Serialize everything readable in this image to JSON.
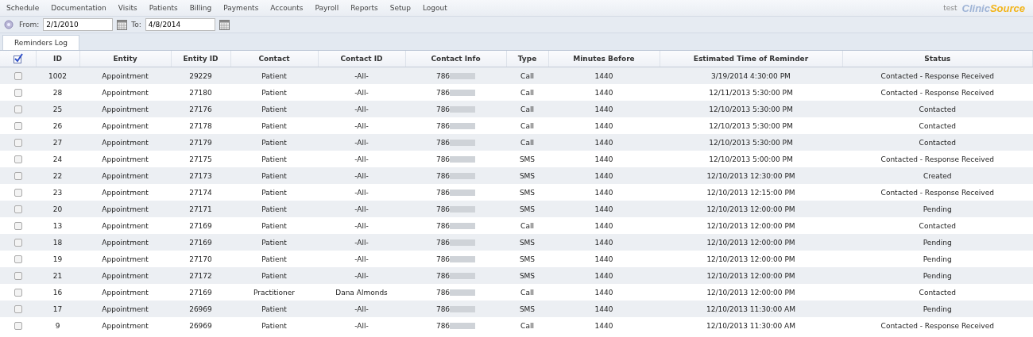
{
  "menu": [
    "Schedule",
    "Documentation",
    "Visits",
    "Patients",
    "Billing",
    "Payments",
    "Accounts",
    "Payroll",
    "Reports",
    "Setup",
    "Logout"
  ],
  "user": "test",
  "logo": {
    "part1": "Clinic",
    "part2": "Source"
  },
  "filters": {
    "from_label": "From:",
    "from_value": "2/1/2010",
    "to_label": "To:",
    "to_value": "4/8/2014"
  },
  "tabs": [
    {
      "label": "Reminders Log",
      "selected": true
    }
  ],
  "table": {
    "columns": [
      "ID",
      "Entity",
      "Entity ID",
      "Contact",
      "Contact ID",
      "Contact Info",
      "Type",
      "Minutes Before",
      "Estimated Time of Reminder",
      "Status"
    ],
    "rows": [
      {
        "checked": false,
        "cells": [
          "1002",
          "Appointment",
          "29229",
          "Patient",
          "-All-",
          "786",
          "Call",
          "1440",
          "3/19/2014 4:30:00 PM",
          "Contacted - Response Received"
        ]
      },
      {
        "checked": false,
        "cells": [
          "28",
          "Appointment",
          "27180",
          "Patient",
          "-All-",
          "786",
          "Call",
          "1440",
          "12/11/2013 5:30:00 PM",
          "Contacted - Response Received"
        ]
      },
      {
        "checked": false,
        "cells": [
          "25",
          "Appointment",
          "27176",
          "Patient",
          "-All-",
          "786",
          "Call",
          "1440",
          "12/10/2013 5:30:00 PM",
          "Contacted"
        ]
      },
      {
        "checked": false,
        "cells": [
          "26",
          "Appointment",
          "27178",
          "Patient",
          "-All-",
          "786",
          "Call",
          "1440",
          "12/10/2013 5:30:00 PM",
          "Contacted"
        ]
      },
      {
        "checked": false,
        "cells": [
          "27",
          "Appointment",
          "27179",
          "Patient",
          "-All-",
          "786",
          "Call",
          "1440",
          "12/10/2013 5:30:00 PM",
          "Contacted"
        ]
      },
      {
        "checked": false,
        "cells": [
          "24",
          "Appointment",
          "27175",
          "Patient",
          "-All-",
          "786",
          "SMS",
          "1440",
          "12/10/2013 5:00:00 PM",
          "Contacted - Response Received"
        ]
      },
      {
        "checked": false,
        "cells": [
          "22",
          "Appointment",
          "27173",
          "Patient",
          "-All-",
          "786",
          "SMS",
          "1440",
          "12/10/2013 12:30:00 PM",
          "Created"
        ]
      },
      {
        "checked": false,
        "cells": [
          "23",
          "Appointment",
          "27174",
          "Patient",
          "-All-",
          "786",
          "SMS",
          "1440",
          "12/10/2013 12:15:00 PM",
          "Contacted - Response Received"
        ]
      },
      {
        "checked": false,
        "cells": [
          "20",
          "Appointment",
          "27171",
          "Patient",
          "-All-",
          "786",
          "SMS",
          "1440",
          "12/10/2013 12:00:00 PM",
          "Pending"
        ]
      },
      {
        "checked": false,
        "cells": [
          "13",
          "Appointment",
          "27169",
          "Patient",
          "-All-",
          "786",
          "Call",
          "1440",
          "12/10/2013 12:00:00 PM",
          "Contacted"
        ]
      },
      {
        "checked": false,
        "cells": [
          "18",
          "Appointment",
          "27169",
          "Patient",
          "-All-",
          "786",
          "SMS",
          "1440",
          "12/10/2013 12:00:00 PM",
          "Pending"
        ]
      },
      {
        "checked": false,
        "cells": [
          "19",
          "Appointment",
          "27170",
          "Patient",
          "-All-",
          "786",
          "SMS",
          "1440",
          "12/10/2013 12:00:00 PM",
          "Pending"
        ]
      },
      {
        "checked": false,
        "cells": [
          "21",
          "Appointment",
          "27172",
          "Patient",
          "-All-",
          "786",
          "SMS",
          "1440",
          "12/10/2013 12:00:00 PM",
          "Pending"
        ]
      },
      {
        "checked": false,
        "cells": [
          "16",
          "Appointment",
          "27169",
          "Practitioner",
          "Dana Almonds",
          "786",
          "Call",
          "1440",
          "12/10/2013 12:00:00 PM",
          "Contacted"
        ]
      },
      {
        "checked": false,
        "cells": [
          "17",
          "Appointment",
          "26969",
          "Patient",
          "-All-",
          "786",
          "SMS",
          "1440",
          "12/10/2013 11:30:00 AM",
          "Pending"
        ]
      },
      {
        "checked": false,
        "cells": [
          "9",
          "Appointment",
          "26969",
          "Patient",
          "-All-",
          "786",
          "Call",
          "1440",
          "12/10/2013 11:30:00 AM",
          "Contacted - Response Received"
        ]
      }
    ]
  }
}
